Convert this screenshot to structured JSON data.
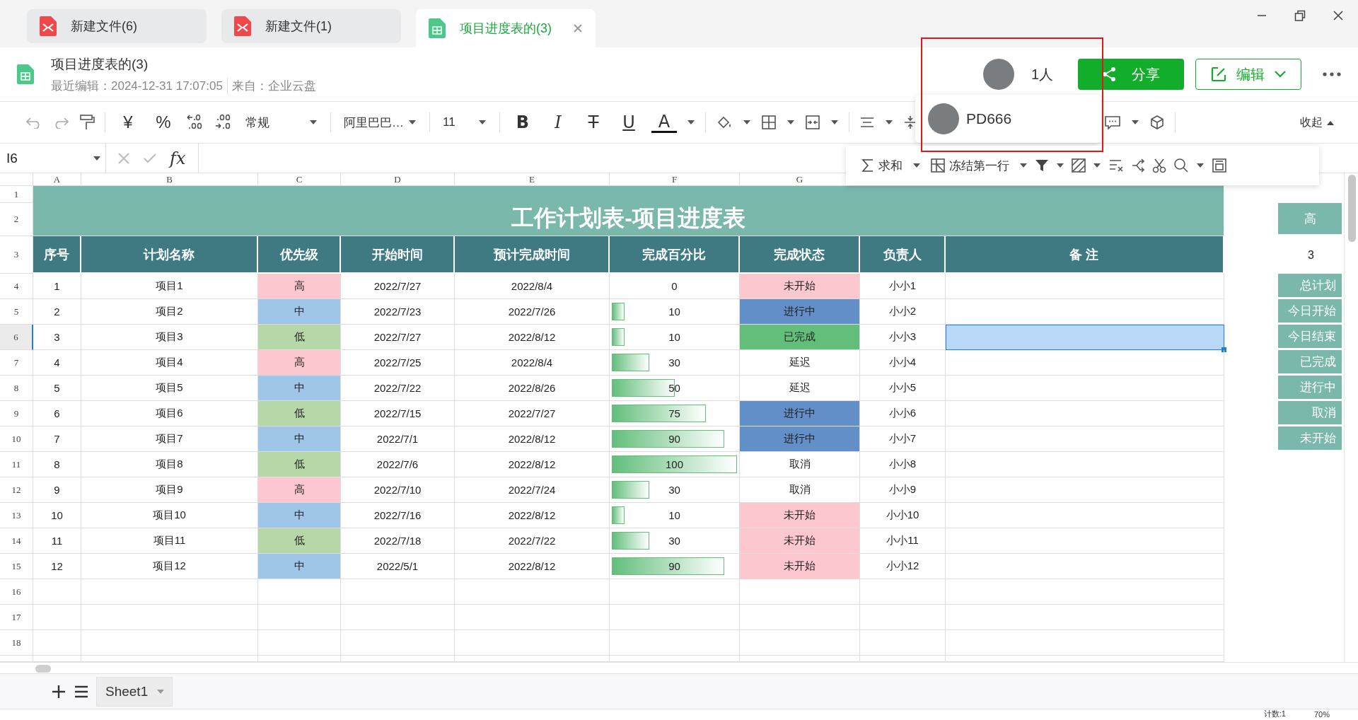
{
  "tabs": [
    {
      "title": "新建文件(6)",
      "kind": "pdf",
      "selected": false
    },
    {
      "title": "新建文件(1)",
      "kind": "pdf",
      "selected": false
    },
    {
      "title": "项目进度表的(3)",
      "kind": "sheet",
      "selected": true
    }
  ],
  "document": {
    "title": "项目进度表的(3)",
    "last_edited": "最近编辑：2024-12-31 17:07:05",
    "source": "来自：企业云盘"
  },
  "collaborators": {
    "count": "1人",
    "users": [
      {
        "name": "PD666"
      }
    ]
  },
  "actions": {
    "share": "分享",
    "edit": "编辑"
  },
  "toolbar": {
    "currency": "¥",
    "percent": "%",
    "number_format": "常规",
    "font": "阿里巴巴…",
    "font_size": "11",
    "format_buttons": [
      {
        "kind": "bold",
        "label": "B"
      },
      {
        "kind": "italic",
        "label": "I"
      },
      {
        "kind": "strike",
        "label": "T"
      },
      {
        "kind": "underline",
        "label": "U"
      },
      {
        "kind": "color",
        "label": "A"
      }
    ],
    "collapse": "收起"
  },
  "quick_toolbar": {
    "sum": "求和",
    "freeze": "冻结第一行"
  },
  "formula_bar": {
    "cell": "I6",
    "fx": "fx"
  },
  "sheet": {
    "columns": [
      "A",
      "B",
      "C",
      "D",
      "E",
      "F",
      "G"
    ],
    "row_numbers": [
      "1",
      "2",
      "3",
      "4",
      "5",
      "6",
      "7",
      "8",
      "9",
      "10",
      "11",
      "12",
      "13",
      "14",
      "15",
      "16",
      "17",
      "18"
    ],
    "title": "工作计划表-项目进度表",
    "headers": [
      "序号",
      "计划名称",
      "优先级",
      "开始时间",
      "预计完成时间",
      "完成百分比",
      "完成状态",
      "负责人",
      "备 注"
    ],
    "rows": [
      {
        "no": "1",
        "name": "项目1",
        "priority": {
          "text": "高",
          "color": "#fcc7cf"
        },
        "start": "2022/7/27",
        "end": "2022/8/4",
        "percent": "0",
        "level": 0,
        "status": {
          "text": "未开始",
          "color": "#fcc7cf"
        },
        "owner": "小小1",
        "selected": false
      },
      {
        "no": "2",
        "name": "项目2",
        "priority": {
          "text": "中",
          "color": "#9fc5e8"
        },
        "start": "2022/7/23",
        "end": "2022/7/26",
        "percent": "10",
        "level": 0.1,
        "status": {
          "text": "进行中",
          "color": "#628fc8"
        },
        "owner": "小小2",
        "selected": false
      },
      {
        "no": "3",
        "name": "项目3",
        "priority": {
          "text": "低",
          "color": "#b6d7a8"
        },
        "start": "2022/7/27",
        "end": "2022/8/12",
        "percent": "10",
        "level": 0.1,
        "status": {
          "text": "已完成",
          "color": "#63be7b"
        },
        "owner": "小小3",
        "selected": true
      },
      {
        "no": "4",
        "name": "项目4",
        "priority": {
          "text": "高",
          "color": "#fcc7cf"
        },
        "start": "2022/7/25",
        "end": "2022/8/4",
        "percent": "30",
        "level": 0.3,
        "status": {
          "text": "延迟"
        },
        "owner": "小小4",
        "selected": false
      },
      {
        "no": "5",
        "name": "项目5",
        "priority": {
          "text": "中",
          "color": "#9fc5e8"
        },
        "start": "2022/7/22",
        "end": "2022/8/26",
        "percent": "50",
        "level": 0.5,
        "status": {
          "text": "延迟"
        },
        "owner": "小小5",
        "selected": false
      },
      {
        "no": "6",
        "name": "项目6",
        "priority": {
          "text": "低",
          "color": "#b6d7a8"
        },
        "start": "2022/7/15",
        "end": "2022/7/27",
        "percent": "75",
        "level": 0.75,
        "status": {
          "text": "进行中",
          "color": "#628fc8"
        },
        "owner": "小小6",
        "selected": false
      },
      {
        "no": "7",
        "name": "项目7",
        "priority": {
          "text": "中",
          "color": "#9fc5e8"
        },
        "start": "2022/7/1",
        "end": "2022/8/12",
        "percent": "90",
        "level": 0.9,
        "status": {
          "text": "进行中",
          "color": "#628fc8"
        },
        "owner": "小小7",
        "selected": false
      },
      {
        "no": "8",
        "name": "项目8",
        "priority": {
          "text": "低",
          "color": "#b6d7a8"
        },
        "start": "2022/7/6",
        "end": "2022/8/12",
        "percent": "100",
        "level": 1,
        "status": {
          "text": "取消"
        },
        "owner": "小小8",
        "selected": false
      },
      {
        "no": "9",
        "name": "项目9",
        "priority": {
          "text": "高",
          "color": "#fcc7cf"
        },
        "start": "2022/7/10",
        "end": "2022/7/24",
        "percent": "30",
        "level": 0.3,
        "status": {
          "text": "取消"
        },
        "owner": "小小9",
        "selected": false
      },
      {
        "no": "10",
        "name": "项目10",
        "priority": {
          "text": "中",
          "color": "#9fc5e8"
        },
        "start": "2022/7/16",
        "end": "2022/8/12",
        "percent": "10",
        "level": 0.1,
        "status": {
          "text": "未开始",
          "color": "#fcc7cf"
        },
        "owner": "小小10",
        "selected": false
      },
      {
        "no": "11",
        "name": "项目11",
        "priority": {
          "text": "低",
          "color": "#b6d7a8"
        },
        "start": "2022/7/18",
        "end": "2022/7/22",
        "percent": "30",
        "level": 0.3,
        "status": {
          "text": "未开始",
          "color": "#fcc7cf"
        },
        "owner": "小小11",
        "selected": false
      },
      {
        "no": "12",
        "name": "项目12",
        "priority": {
          "text": "中",
          "color": "#9fc5e8"
        },
        "start": "2022/5/1",
        "end": "2022/8/12",
        "percent": "90",
        "level": 0.9,
        "status": {
          "text": "未开始",
          "color": "#fcc7cf"
        },
        "owner": "小小12",
        "selected": false
      }
    ],
    "side_panel": {
      "header": "高",
      "value": "3",
      "labels": [
        "总计划",
        "今日开始",
        "今日结束",
        "已完成",
        "进行中",
        "取消",
        "未开始"
      ]
    }
  },
  "sheet_tabs": [
    {
      "name": "Sheet1",
      "selected": true
    }
  ],
  "status_bar": {
    "count": "计数:1",
    "zoom": "70%"
  }
}
